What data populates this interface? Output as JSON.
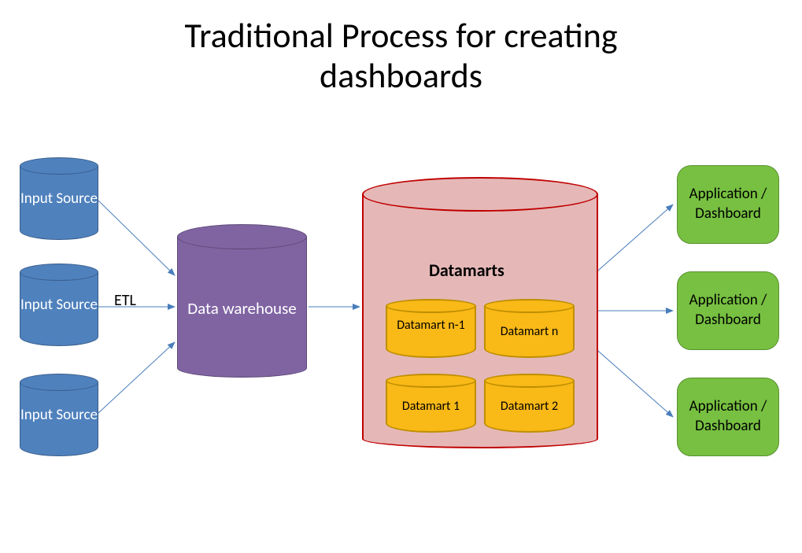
{
  "title_line1": "Traditional Process for creating",
  "title_line2": "dashboards",
  "inputs": {
    "label": "Input\nSource",
    "item1": "Input Source",
    "item2": "Input Source",
    "item3": "Input Source"
  },
  "etl_label": "ETL",
  "warehouse_label": "Data warehouse",
  "datamarts_container_label": "Datamarts",
  "datamarts": {
    "dm1": "Datamart 1",
    "dm2": "Datamart 2",
    "dm_n_minus_1": "Datamart n-1",
    "dm_n": "Datamart n"
  },
  "app_label": "Application / Dashboard",
  "apps": {
    "app1": "Application / Dashboard",
    "app2": "Application / Dashboard",
    "app3": "Application / Dashboard"
  },
  "colors": {
    "input_fill": "#4f81bd",
    "warehouse_fill": "#8064a2",
    "datamarts_fill": "#e5b8b7",
    "datamarts_border": "#c00000",
    "datamart_small_fill": "#f9b917",
    "app_fill": "#77c041",
    "arrow": "#4a7ebb"
  }
}
